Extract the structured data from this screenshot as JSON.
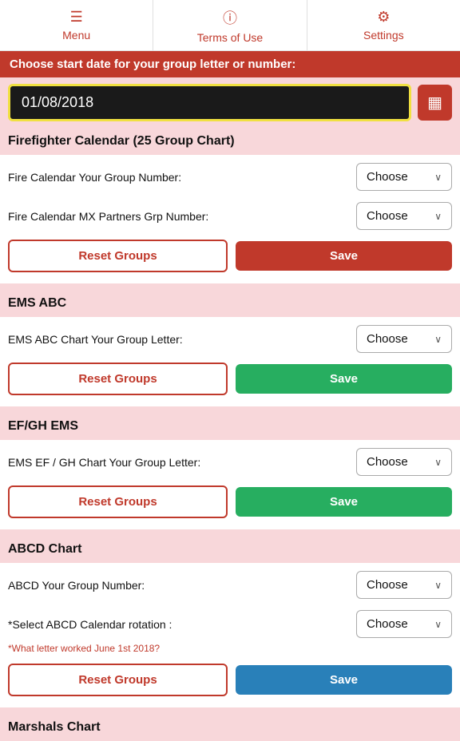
{
  "nav": {
    "menu_label": "Menu",
    "menu_icon": "☰",
    "terms_label": "Terms of Use",
    "terms_icon": "ⓘ",
    "settings_label": "Settings",
    "settings_icon": "⚙"
  },
  "instruction": "Choose start date for your group letter or number:",
  "date_value": "01/08/2018",
  "calendar_icon": "▦",
  "sections": [
    {
      "id": "firefighter",
      "header": "Firefighter Calendar (25 Group Chart)",
      "rows": [
        {
          "label": "Fire Calendar Your Group Number:",
          "choose_label": "Choose"
        },
        {
          "label": "Fire Calendar MX Partners Grp Number:",
          "choose_label": "Choose"
        }
      ],
      "reset_label": "Reset Groups",
      "save_label": "Save",
      "save_style": "red"
    },
    {
      "id": "ems-abc",
      "header": "EMS ABC",
      "rows": [
        {
          "label": "EMS ABC Chart Your Group Letter:",
          "choose_label": "Choose"
        }
      ],
      "reset_label": "Reset Groups",
      "save_label": "Save",
      "save_style": "green"
    },
    {
      "id": "ef-gh-ems",
      "header": "EF/GH EMS",
      "rows": [
        {
          "label": "EMS EF / GH Chart Your Group Letter:",
          "choose_label": "Choose"
        }
      ],
      "reset_label": "Reset Groups",
      "save_label": "Save",
      "save_style": "green"
    },
    {
      "id": "abcd",
      "header": "ABCD Chart",
      "rows": [
        {
          "label": "ABCD Your Group Number:",
          "choose_label": "Choose"
        },
        {
          "label": "*Select ABCD Calendar rotation :",
          "choose_label": "Choose",
          "hint": "*What letter worked June 1st 2018?"
        }
      ],
      "reset_label": "Reset Groups",
      "save_label": "Save",
      "save_style": "blue"
    }
  ],
  "marshals_header": "Marshals Chart"
}
